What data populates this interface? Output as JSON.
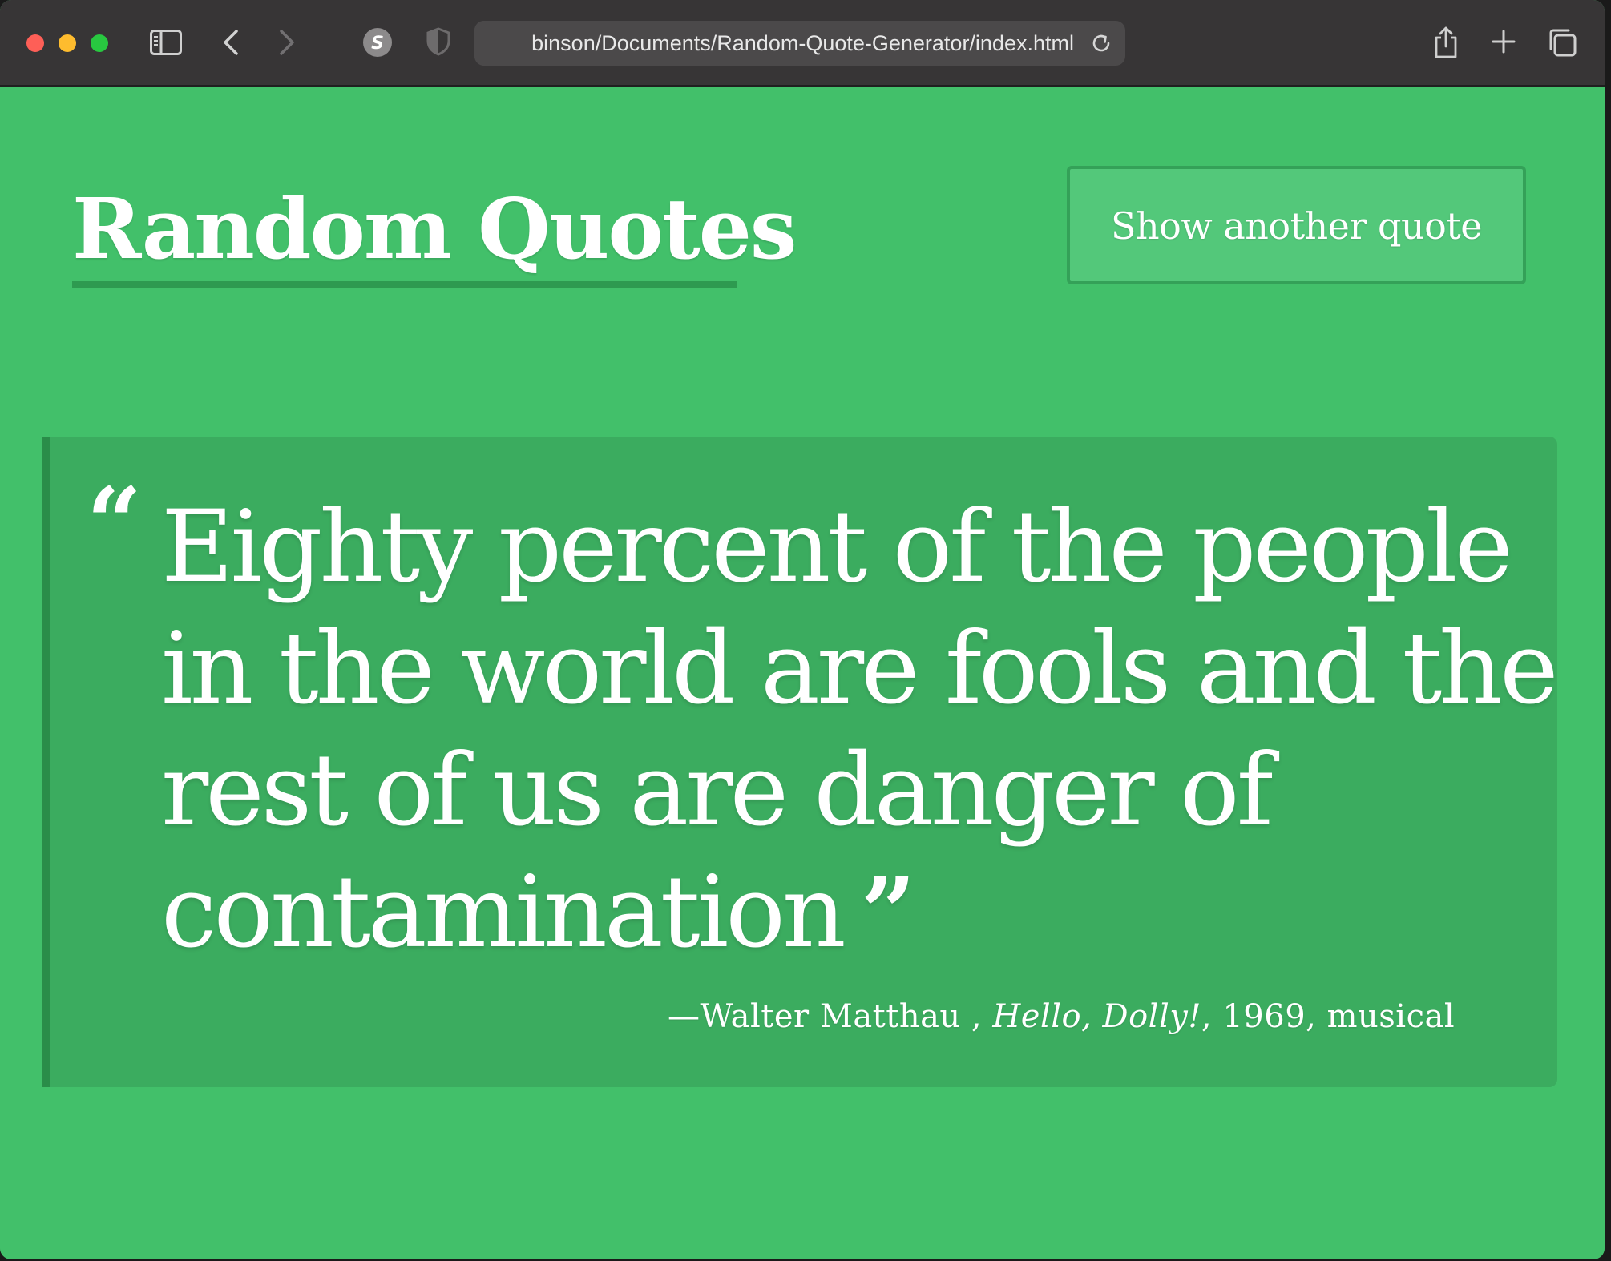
{
  "browser": {
    "url": "binson/Documents/Random-Quote-Generator/index.html",
    "extension_badge": "S",
    "traffic_colors": {
      "close": "#fe5f57",
      "minimize": "#febc2e",
      "zoom": "#28c840"
    }
  },
  "page": {
    "background": "#42c06a",
    "title": "Random Quotes",
    "button_label": "Show another quote",
    "quote": {
      "open_mark": "“",
      "text": "Eighty percent of the people in the world are fools and the rest of us are danger of contamination",
      "close_mark": "”",
      "dash": "—",
      "source": "Walter Matthau",
      "citation_sep": " , ",
      "citation": "Hello, Dolly!",
      "year_sep": ", ",
      "year": "1969",
      "tag_sep": ", ",
      "tag": "musical"
    }
  }
}
